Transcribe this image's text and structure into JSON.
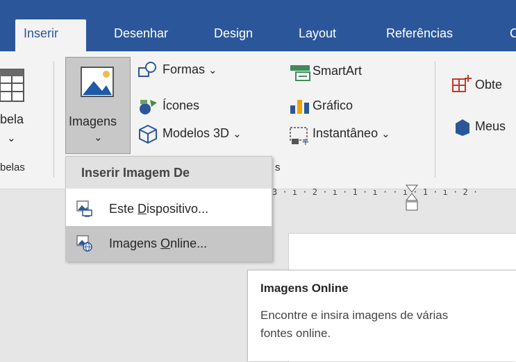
{
  "tabs": [
    "Inserir",
    "Desenhar",
    "Design",
    "Layout",
    "Referências",
    "C"
  ],
  "ribbon": {
    "table_label": "bela",
    "table_group": "belas",
    "images_label": "Imagens",
    "formas": "Formas",
    "icones": "Ícones",
    "modelos3d": "Modelos 3D",
    "smartart": "SmartArt",
    "grafico": "Gráfico",
    "instantaneo": "Instantâneo",
    "obter": "Obte",
    "meus": "Meus",
    "group_fragment": "s"
  },
  "ruler_text": "3 · ı · 2 · ı · 1 · ı ·   · ı · 1 · ı · 2 ·",
  "menu": {
    "header": "Inserir Imagem De",
    "items": [
      {
        "pre": "Este ",
        "acc": "D",
        "post": "ispositivo..."
      },
      {
        "pre": "Imagens ",
        "acc": "O",
        "post": "nline..."
      }
    ]
  },
  "tooltip": {
    "title": "Imagens Online",
    "description": "Encontre e insira imagens de várias fontes online."
  },
  "colors": {
    "accent": "#2b579a",
    "ribbon_bg": "#f3f3f3",
    "hover": "#c6c6c6"
  }
}
